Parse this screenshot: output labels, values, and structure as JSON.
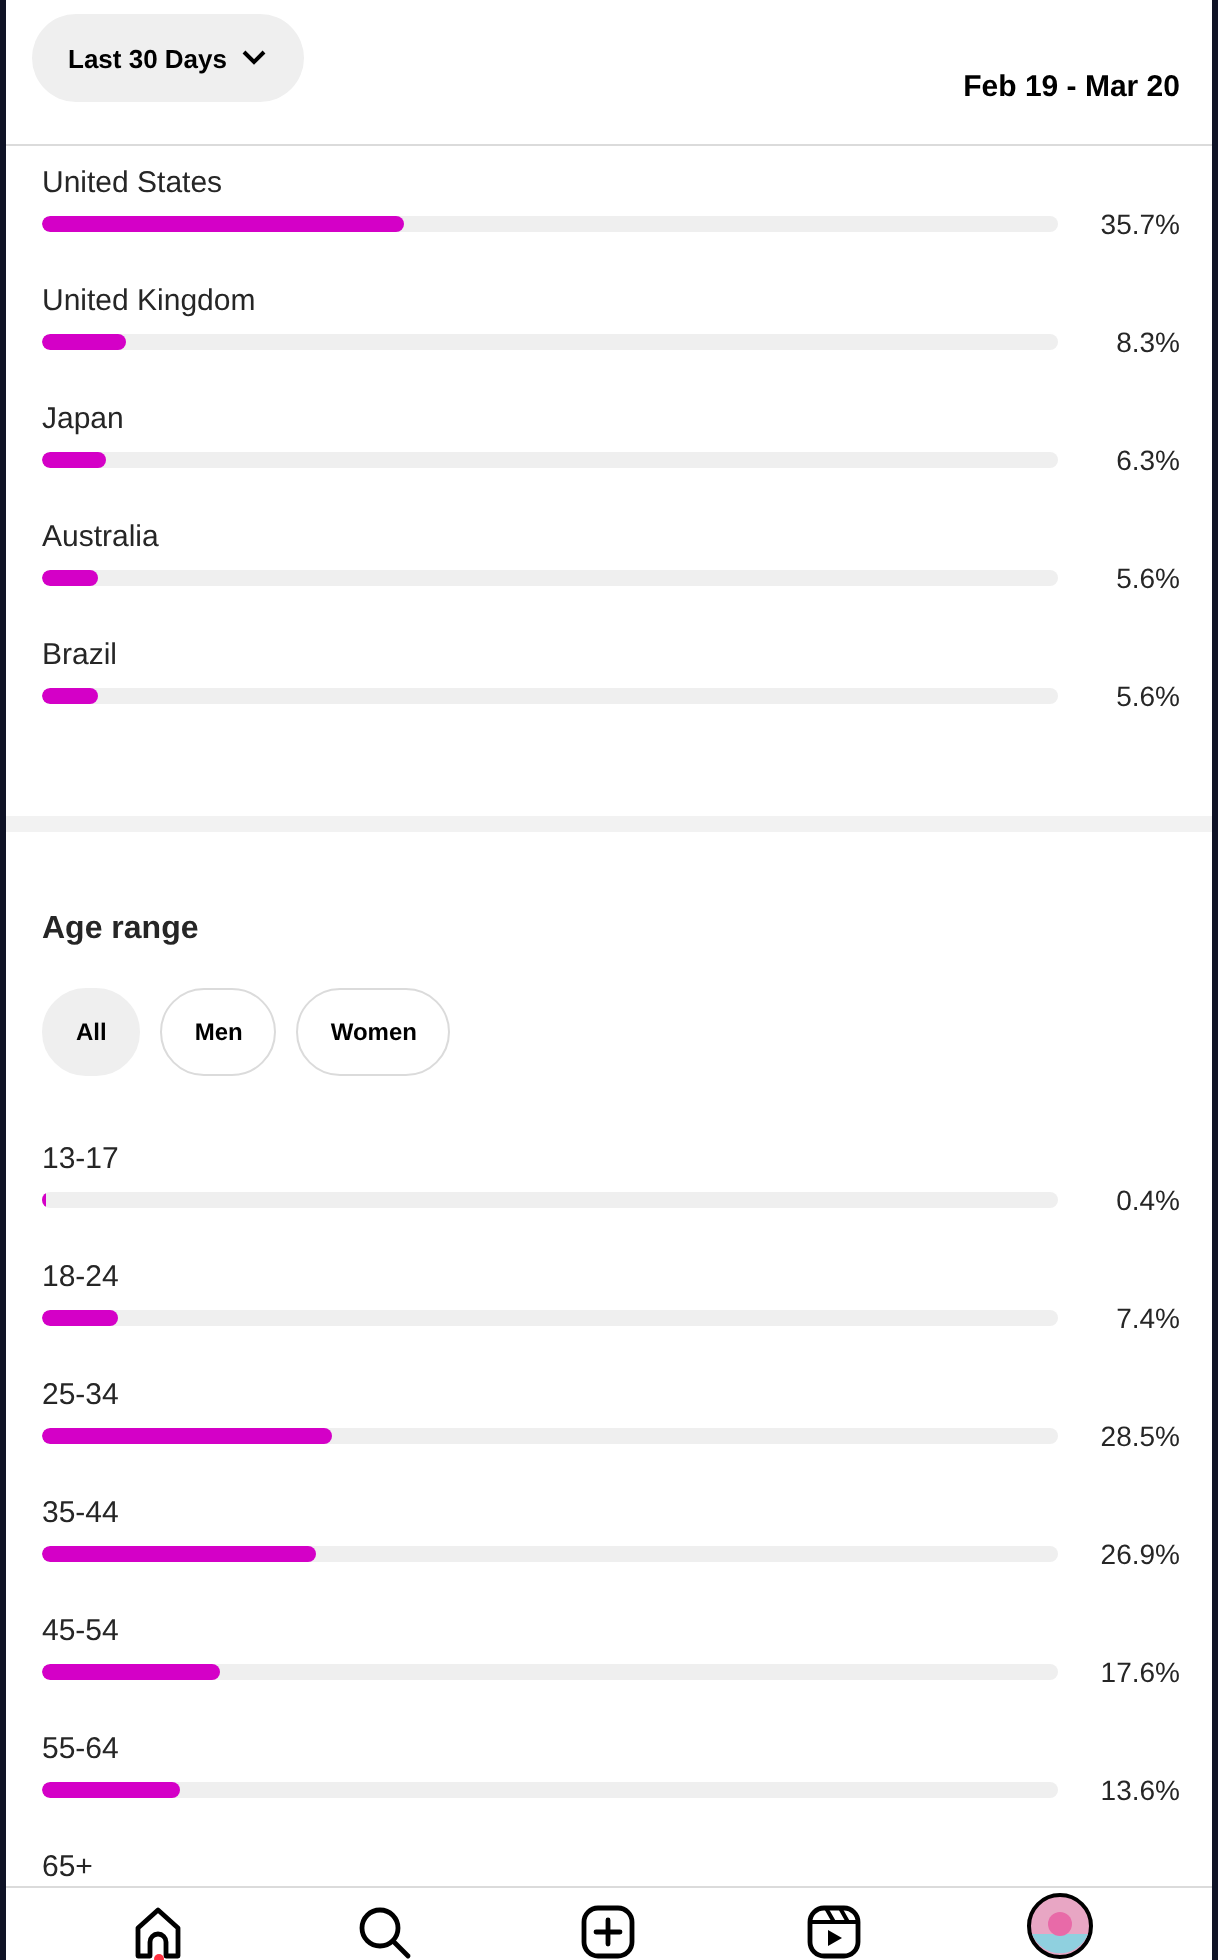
{
  "header": {
    "range_button": "Last 30 Days",
    "date_range": "Feb 19 - Mar 20"
  },
  "countries": [
    {
      "name": "United States",
      "level": 0.357,
      "reading": "35.7%"
    },
    {
      "name": "United Kingdom",
      "level": 0.083,
      "reading": "8.3%"
    },
    {
      "name": "Japan",
      "level": 0.063,
      "reading": "6.3%"
    },
    {
      "name": "Australia",
      "level": 0.056,
      "reading": "5.6%"
    },
    {
      "name": "Brazil",
      "level": 0.056,
      "reading": "5.6%"
    }
  ],
  "age_range": {
    "title": "Age range",
    "filters": [
      {
        "label": "All",
        "selected": true
      },
      {
        "label": "Men",
        "selected": false
      },
      {
        "label": "Women",
        "selected": false
      }
    ],
    "rows": [
      {
        "name": "13-17",
        "level": 0.004,
        "reading": "0.4%"
      },
      {
        "name": "18-24",
        "level": 0.074,
        "reading": "7.4%"
      },
      {
        "name": "25-34",
        "level": 0.285,
        "reading": "28.5%"
      },
      {
        "name": "35-44",
        "level": 0.269,
        "reading": "26.9%"
      },
      {
        "name": "45-54",
        "level": 0.176,
        "reading": "17.6%"
      },
      {
        "name": "55-64",
        "level": 0.136,
        "reading": "13.6%"
      },
      {
        "name": "65+"
      }
    ]
  },
  "nav": [
    {
      "kind": "home",
      "badge": true
    },
    {
      "kind": "search",
      "badge": false
    },
    {
      "kind": "create",
      "badge": false
    },
    {
      "kind": "reels",
      "badge": false
    },
    {
      "kind": "profile",
      "badge": false
    }
  ]
}
